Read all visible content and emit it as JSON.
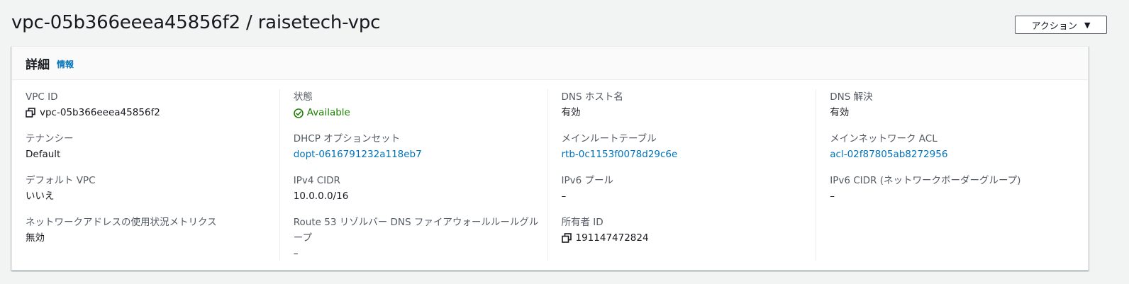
{
  "header": {
    "title": "vpc-05b366eeea45856f2 / raisetech-vpc",
    "actions_label": "アクション",
    "actions_caret": "▼"
  },
  "details": {
    "title": "詳細",
    "info_link": "情報",
    "columns": [
      [
        {
          "label": "VPC ID",
          "value": "vpc-05b366eeea45856f2",
          "icon": "copy-icon"
        },
        {
          "label": "テナンシー",
          "value": "Default"
        },
        {
          "label": "デフォルト VPC",
          "value": "いいえ"
        },
        {
          "label": "ネットワークアドレスの使用状況メトリクス",
          "value": "無効"
        }
      ],
      [
        {
          "label": "状態",
          "value": "Available",
          "icon": "status-success-icon",
          "status_color": "#1d8102"
        },
        {
          "label": "DHCP オプションセット",
          "value": "dopt-0616791232a118eb7",
          "link": true
        },
        {
          "label": "IPv4 CIDR",
          "value": "10.0.0.0/16"
        },
        {
          "label": "Route 53 リゾルバー DNS ファイアウォールルールグループ",
          "value": "–"
        }
      ],
      [
        {
          "label": "DNS ホスト名",
          "value": "有効"
        },
        {
          "label": "メインルートテーブル",
          "value": "rtb-0c1153f0078d29c6e",
          "link": true
        },
        {
          "label": "IPv6 プール",
          "value": "–"
        },
        {
          "label": "所有者 ID",
          "value": "191147472824",
          "icon": "copy-icon"
        }
      ],
      [
        {
          "label": "DNS 解決",
          "value": "有効"
        },
        {
          "label": "メインネットワーク ACL",
          "value": "acl-02f87805ab8272956",
          "link": true
        },
        {
          "label": "IPv6 CIDR (ネットワークボーダーグループ)",
          "value": "–"
        }
      ]
    ]
  },
  "colors": {
    "link": "#0073bb",
    "success": "#1d8102",
    "label": "#545b64",
    "text": "#16191f",
    "background": "#f2f3f3"
  }
}
